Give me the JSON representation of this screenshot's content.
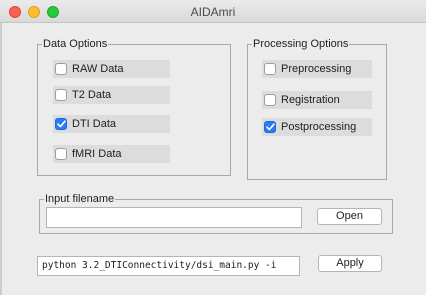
{
  "window": {
    "title": "AIDAmri"
  },
  "data_options": {
    "legend": "Data Options",
    "items": [
      {
        "label": "RAW Data",
        "checked": false
      },
      {
        "label": "T2 Data",
        "checked": false
      },
      {
        "label": "DTI Data",
        "checked": true
      },
      {
        "label": "fMRI Data",
        "checked": false
      }
    ]
  },
  "processing_options": {
    "legend": "Processing Options",
    "items": [
      {
        "label": "Preprocessing",
        "checked": false
      },
      {
        "label": "Registration",
        "checked": false
      },
      {
        "label": "Postprocessing",
        "checked": true
      }
    ]
  },
  "input": {
    "legend": "Input filename",
    "value": "",
    "open_label": "Open"
  },
  "command": {
    "value": "python 3.2_DTIConnectivity/dsi_main.py -i",
    "apply_label": "Apply"
  },
  "colors": {
    "accent": "#2a7cf6"
  }
}
